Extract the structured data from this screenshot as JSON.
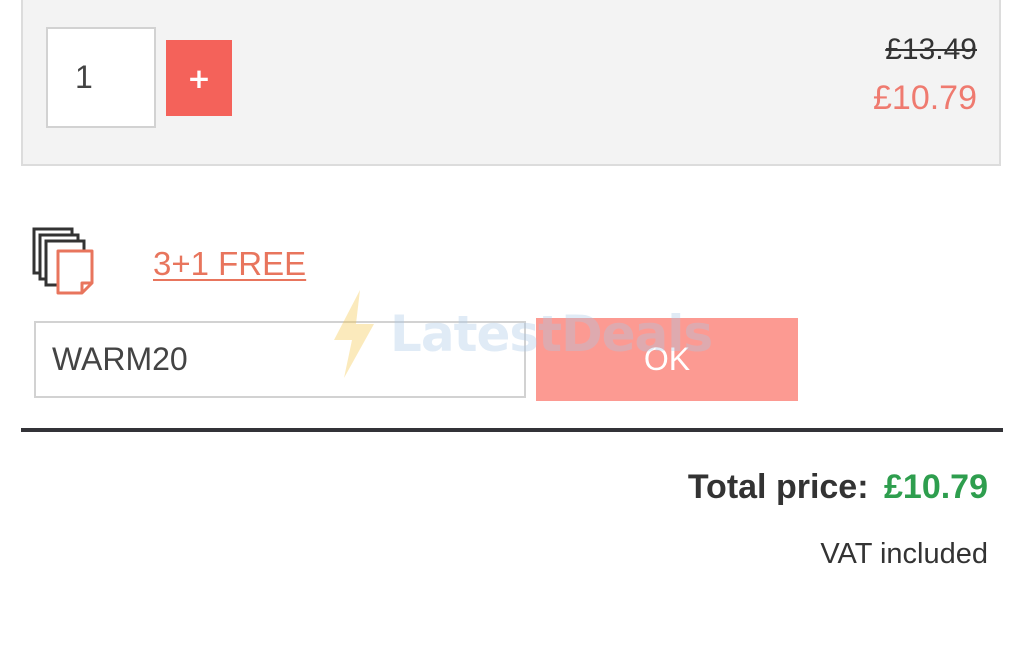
{
  "product": {
    "quantity_value": "1",
    "plus_label": "+",
    "old_price": "£13.49",
    "new_price": "£10.79"
  },
  "promo": {
    "icon": "stacked-documents-icon",
    "offer_link": "3+1 FREE"
  },
  "coupon": {
    "code_value": "WARM20",
    "ok_label": "OK"
  },
  "watermark": {
    "icon": "lightning-bolt-icon",
    "text": "LatestDeals"
  },
  "summary": {
    "total_label": "Total price:",
    "total_value": "£10.79",
    "vat_note": "VAT included"
  },
  "colors": {
    "accent": "#f4625a",
    "sale_price": "#ef7a6f",
    "total_green": "#2e9e4e",
    "ok_button": "#fc9a92"
  }
}
